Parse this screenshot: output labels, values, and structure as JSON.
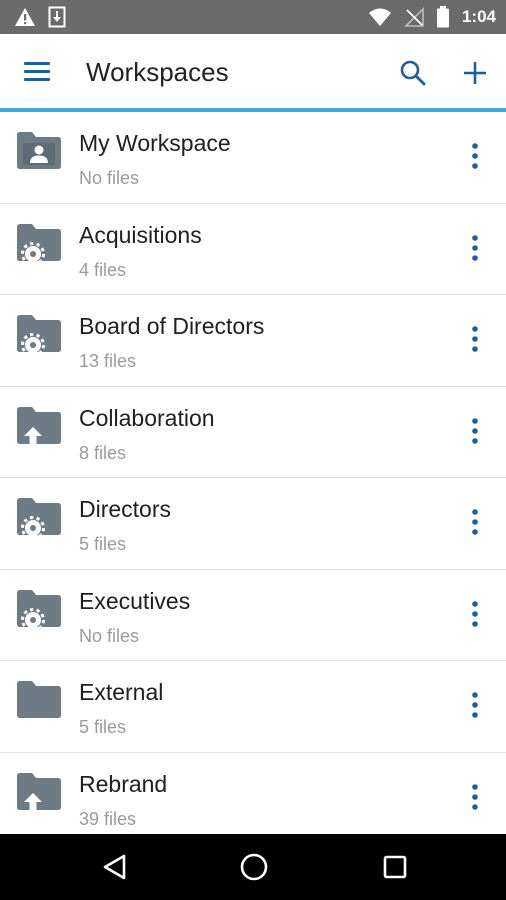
{
  "status_bar": {
    "time": "1:04",
    "left_icons": [
      "warning-icon",
      "download-icon"
    ],
    "right_icons": [
      "wifi-icon",
      "no-signal-icon",
      "battery-icon"
    ]
  },
  "app_bar": {
    "title": "Workspaces",
    "menu_icon": "hamburger-menu-icon",
    "search_icon": "search-icon",
    "add_icon": "plus-icon",
    "accent_color": "#3fa9e6"
  },
  "workspaces": [
    {
      "name": "My Workspace",
      "count": "No files",
      "icon": "person-folder-icon"
    },
    {
      "name": "Acquisitions",
      "count": "4 files",
      "icon": "gear-folder-icon"
    },
    {
      "name": "Board of Directors",
      "count": "13 files",
      "icon": "gear-folder-icon"
    },
    {
      "name": "Collaboration",
      "count": "8 files",
      "icon": "upload-folder-icon"
    },
    {
      "name": "Directors",
      "count": "5 files",
      "icon": "gear-folder-icon"
    },
    {
      "name": "Executives",
      "count": "No files",
      "icon": "gear-folder-icon"
    },
    {
      "name": "External",
      "count": "5 files",
      "icon": "folder-icon"
    },
    {
      "name": "Rebrand",
      "count": "39 files",
      "icon": "upload-folder-icon"
    }
  ],
  "nav_bar": {
    "back_icon": "back-icon",
    "home_icon": "home-icon",
    "recents_icon": "recents-icon"
  },
  "colors": {
    "status_bar": "#6b6b6b",
    "folder_icon": "#6e7a84",
    "primary_icon": "#1f5e9c",
    "secondary_text": "#9a9a9a"
  }
}
